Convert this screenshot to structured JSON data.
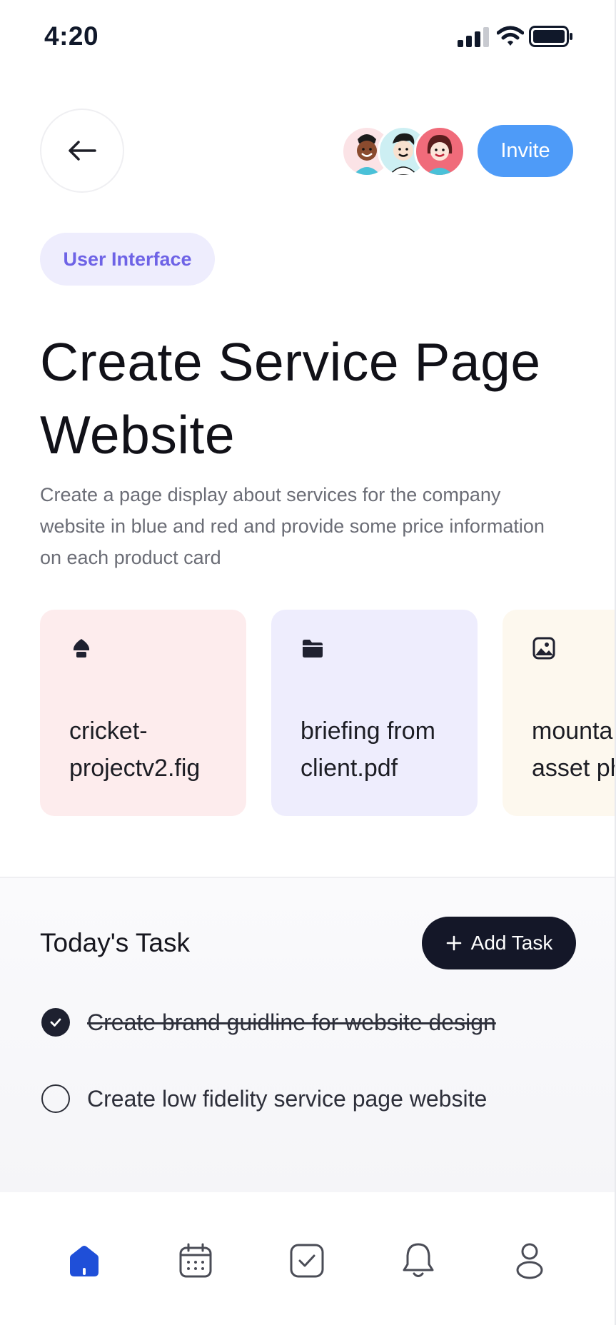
{
  "status_bar": {
    "time": "4:20"
  },
  "header": {
    "invite_label": "Invite",
    "avatars": [
      "avatar-1",
      "avatar-2",
      "avatar-3"
    ]
  },
  "project": {
    "tag": "User Interface",
    "title": "Create Service Page Website",
    "description": "Create a page display about services for the company website in blue and red and provide some price information on each product card"
  },
  "files": [
    {
      "name": "cricket-projectv2.fig",
      "icon": "figma-pen-icon",
      "color": "#fdeced"
    },
    {
      "name": "briefing from client.pdf",
      "icon": "folder-icon",
      "color": "#eeedfd"
    },
    {
      "name": "mounta\nasset ph",
      "icon": "image-icon",
      "color": "#fdf8ee"
    }
  ],
  "tasks_section": {
    "title": "Today's Task",
    "add_label": "Add Task",
    "items": [
      {
        "label": "Create brand guidline for website design",
        "done": true
      },
      {
        "label": "Create low fidelity service page website",
        "done": false
      }
    ]
  },
  "nav": {
    "items": [
      "home-icon",
      "calendar-icon",
      "checkbox-icon",
      "bell-icon",
      "profile-icon"
    ],
    "active": "home-icon",
    "active_color": "#1f4fd8"
  },
  "colors": {
    "accent": "#4e9bf8",
    "dark": "#141728",
    "tag_text": "#6e63e6"
  }
}
